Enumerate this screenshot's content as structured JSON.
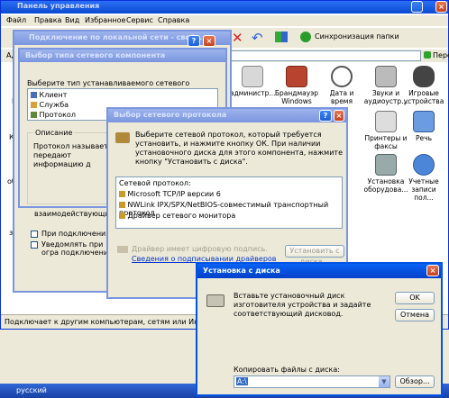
{
  "main_window": {
    "title": "Панель управления",
    "menu": [
      "Файл",
      "Правка",
      "Вид",
      "Избранное",
      "Сервис",
      "Справка"
    ],
    "address_label": "Адрес",
    "go_label": "Пере",
    "toolbar_sync_label": "Синхронизация папки",
    "status_text": "Подключает к другим компьютерам, сетям или Интернету.",
    "icons": [
      {
        "label": "администр...",
        "icon": "admin-tools-icon"
      },
      {
        "label": "Брандмауэр Windows",
        "icon": "firewall-icon"
      },
      {
        "label": "Дата и время",
        "icon": "date-time-icon"
      },
      {
        "label": "Звуки и аудиоустр...",
        "icon": "sound-icon"
      },
      {
        "label": "Игровые устройства",
        "icon": "game-controller-icon"
      },
      {
        "label": "Принтеры и факсы",
        "icon": "printer-icon"
      },
      {
        "label": "Речь",
        "icon": "speech-icon"
      },
      {
        "label": "Установка оборудова...",
        "icon": "hardware-install-icon"
      },
      {
        "label": "Учетные записи пол...",
        "icon": "user-accounts-icon"
      }
    ],
    "left_fragments": [
      "Е",
      "Кл",
      "об",
      "за"
    ]
  },
  "lan_window": {
    "title": "Подключение по локальной сети - свойс...",
    "fragment_1": "взаимодействующими",
    "checkbox_1": "При подключении выв",
    "checkbox_2": "Уведомлять при огра подключении"
  },
  "component_type_dialog": {
    "title": "Выбор типа сетевого компонента",
    "prompt": "Выберите тип устанавливаемого сетевого компонента:",
    "items": [
      "Клиент",
      "Служба",
      "Протокол"
    ],
    "description_label": "Описание",
    "description_text": "Протокол называется передают информацию д"
  },
  "protocol_dialog": {
    "title": "Выбор сетевого протокола",
    "instruction": "Выберите сетевой протокол, который требуется установить, и нажмите кнопку ОК. При наличии установочного диска для этого компонента, нажмите кнопку \"Установить с диска\".",
    "list_label": "Сетевой протокол:",
    "protocols": [
      "Microsoft TCP/IP версии 6",
      "NWLink IPX/SPX/NetBIOS-совместимый транспортный протокол",
      "Драйвер сетевого монитора"
    ],
    "signature_text": "Драйвер имеет цифровую подпись.",
    "signing_link": "Сведения о подписывании драйверов",
    "install_from_disk": "Установить с диска..."
  },
  "disk_dialog": {
    "title": "Установка с диска",
    "message": "Вставьте установочный диск изготовителя устройства и задайте соответствующий дисковод.",
    "ok": "OK",
    "cancel": "Отмена",
    "copy_label": "Копировать файлы с диска:",
    "path_value": "A:\\",
    "browse": "Обзор..."
  },
  "taskbar": {
    "item": "русский"
  },
  "colors": {
    "xp_blue": "#0a246a",
    "title_active": "#0054e3",
    "title_inactive": "#7a96df"
  }
}
